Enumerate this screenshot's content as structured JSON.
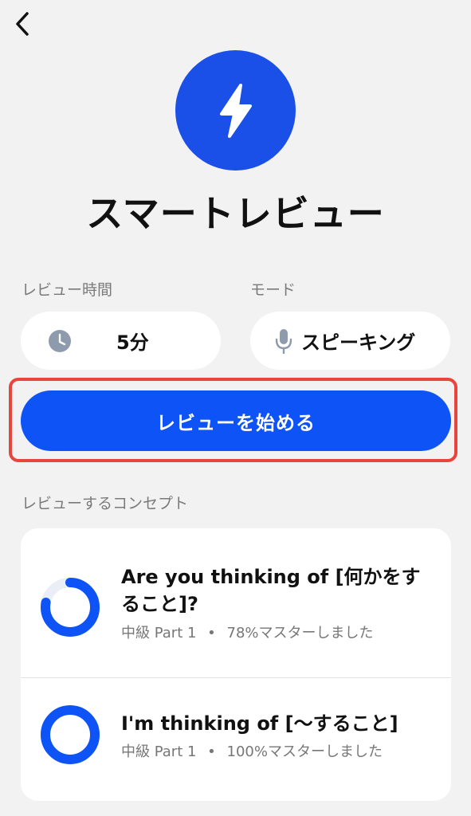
{
  "header": {
    "back_icon": "chevron-left-icon",
    "hero_icon": "lightning-bolt-icon",
    "title": "スマートレビュー"
  },
  "settings": {
    "time_label": "レビュー時間",
    "time_value": "5分",
    "time_icon": "clock-icon",
    "mode_label": "モード",
    "mode_value": "スピーキング",
    "mode_icon": "microphone-icon"
  },
  "start_button": {
    "label": "レビューを始める"
  },
  "concepts": {
    "section_label": "レビューするコンセプト",
    "items": [
      {
        "title": "Are you thinking of [何かをすること]?",
        "level": "中級 Part 1",
        "separator": "•",
        "mastery": "78%マスターしました",
        "mastery_fraction": 0.78
      },
      {
        "title": "I'm thinking of [〜すること]",
        "level": "中級 Part 1",
        "separator": "•",
        "mastery": "100%マスターしました",
        "mastery_fraction": 1.0
      }
    ]
  },
  "colors": {
    "accent": "#0d53f5",
    "hero": "#1a4fe8",
    "highlight_border": "#e8453c",
    "background": "#f2f2f2",
    "muted_text": "#777777"
  }
}
